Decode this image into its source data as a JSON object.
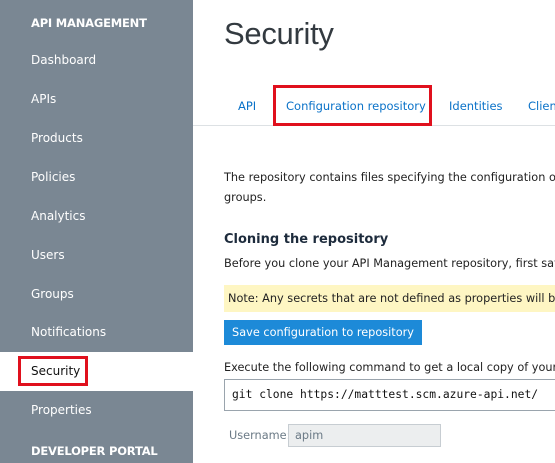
{
  "sidebar": {
    "header_api_management": "API MANAGEMENT",
    "items": [
      {
        "label": "Dashboard"
      },
      {
        "label": "APIs"
      },
      {
        "label": "Products"
      },
      {
        "label": "Policies"
      },
      {
        "label": "Analytics"
      },
      {
        "label": "Users"
      },
      {
        "label": "Groups"
      },
      {
        "label": "Notifications"
      },
      {
        "label": "Security"
      },
      {
        "label": "Properties"
      }
    ],
    "header_developer_portal": "DEVELOPER PORTAL",
    "active_item": "Security"
  },
  "page": {
    "title": "Security"
  },
  "tabs": [
    {
      "label": "API"
    },
    {
      "label": "Configuration repository"
    },
    {
      "label": "Identities"
    },
    {
      "label": "Clien"
    }
  ],
  "active_tab": "Configuration repository",
  "content": {
    "intro_line1": "The repository contains files specifying the configuration of yo",
    "intro_line2": "groups.",
    "section_title": "Cloning the repository",
    "before_clone": "Before you clone your API Management repository, first save t",
    "note": "Note: Any secrets that are not defined as properties will be st",
    "save_button": "Save configuration to repository",
    "execute_text": "Execute the following command to get a local copy of your AP",
    "git_command": "git clone https://matttest.scm.azure-api.net/",
    "username_label": "Username:",
    "username_value": "apim"
  },
  "colors": {
    "sidebar_bg": "#7a8793",
    "highlight_red": "#e0101d",
    "link_blue": "#0a72c8",
    "button_blue": "#1d8ad8",
    "note_bg": "#fef6c3"
  }
}
